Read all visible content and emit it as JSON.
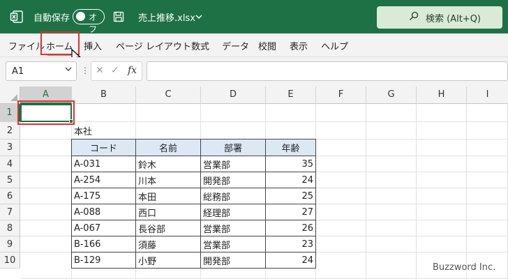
{
  "titlebar": {
    "autosave_label": "自動保存",
    "autosave_state": "オフ",
    "filename": "売上推移.xlsx",
    "search_placeholder": "検索 (Alt+Q)",
    "bg_color": "#1e7145"
  },
  "menu": {
    "items": [
      "ファイル",
      "ホーム",
      "挿入",
      "ページ レイアウト",
      "数式",
      "データ",
      "校閲",
      "表示",
      "ヘルプ"
    ],
    "highlighted": "ホーム"
  },
  "formula_bar": {
    "name_box": "A1",
    "fx_label": "fx",
    "formula": ""
  },
  "sheet": {
    "columns": [
      "A",
      "B",
      "C",
      "D",
      "E",
      "F",
      "G",
      "H",
      "I"
    ],
    "rows": [
      "1",
      "2",
      "3",
      "4",
      "5",
      "6",
      "7",
      "8",
      "9",
      "10"
    ],
    "selected_cell": "A1",
    "caption": "本社",
    "table_headers": [
      "コード",
      "名前",
      "部署",
      "年齢"
    ],
    "table_rows": [
      [
        "A-031",
        "鈴木",
        "営業部",
        "35"
      ],
      [
        "A-254",
        "川本",
        "開発部",
        "24"
      ],
      [
        "A-175",
        "本田",
        "総務部",
        "25"
      ],
      [
        "A-088",
        "西口",
        "経理部",
        "27"
      ],
      [
        "A-067",
        "長谷部",
        "営業部",
        "26"
      ],
      [
        "B-166",
        "須藤",
        "営業部",
        "23"
      ],
      [
        "B-129",
        "小野",
        "開発部",
        "24"
      ]
    ],
    "header_fill": "#dce9f5"
  },
  "watermark": "Buzzword Inc."
}
